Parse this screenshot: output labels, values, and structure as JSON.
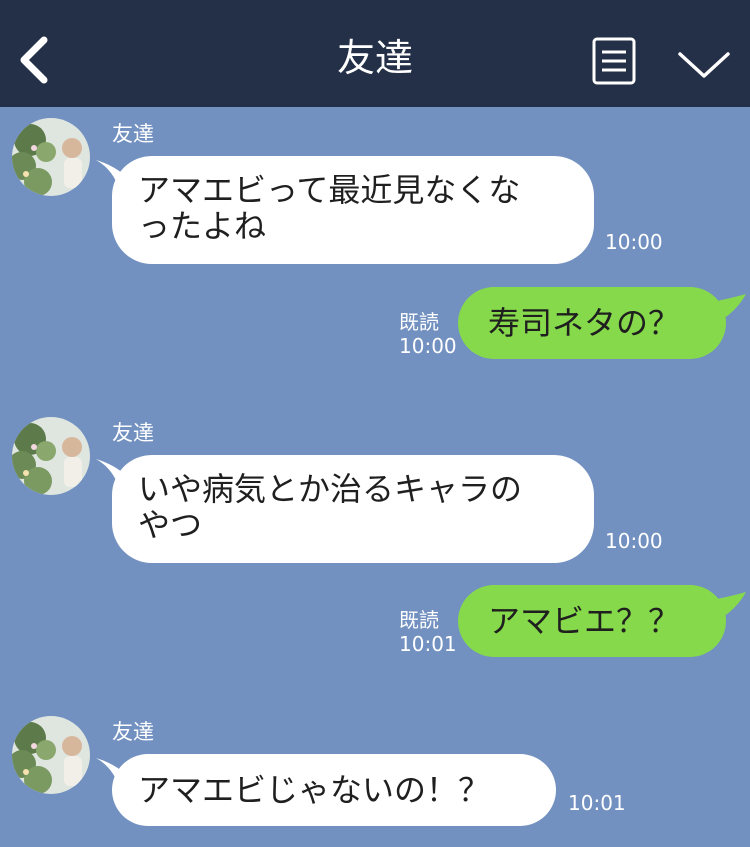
{
  "header": {
    "title": "友達",
    "back_icon": "chevron-left-icon",
    "menu_icon": "list-icon",
    "dropdown_icon": "chevron-down-icon",
    "background": "#243047"
  },
  "chat": {
    "background": "#7291c0",
    "incoming_bubble_color": "#ffffff",
    "outgoing_bubble_color": "#86d94a",
    "messages": [
      {
        "direction": "incoming",
        "sender": "友達",
        "lines": [
          "アマエビって最近見なくな",
          "ったよね"
        ],
        "time": "10:00"
      },
      {
        "direction": "outgoing",
        "text": "寿司ネタの？",
        "read": "既読",
        "time": "10:00"
      },
      {
        "direction": "incoming",
        "sender": "友達",
        "lines": [
          "いや病気とか治るキャラの",
          "やつ"
        ],
        "time": "10:00"
      },
      {
        "direction": "outgoing",
        "text": "アマビエ？？",
        "read": "既読",
        "time": "10:01"
      },
      {
        "direction": "incoming",
        "sender": "友達",
        "lines": [
          "アマエビじゃないの！？"
        ],
        "time": "10:01"
      }
    ]
  }
}
